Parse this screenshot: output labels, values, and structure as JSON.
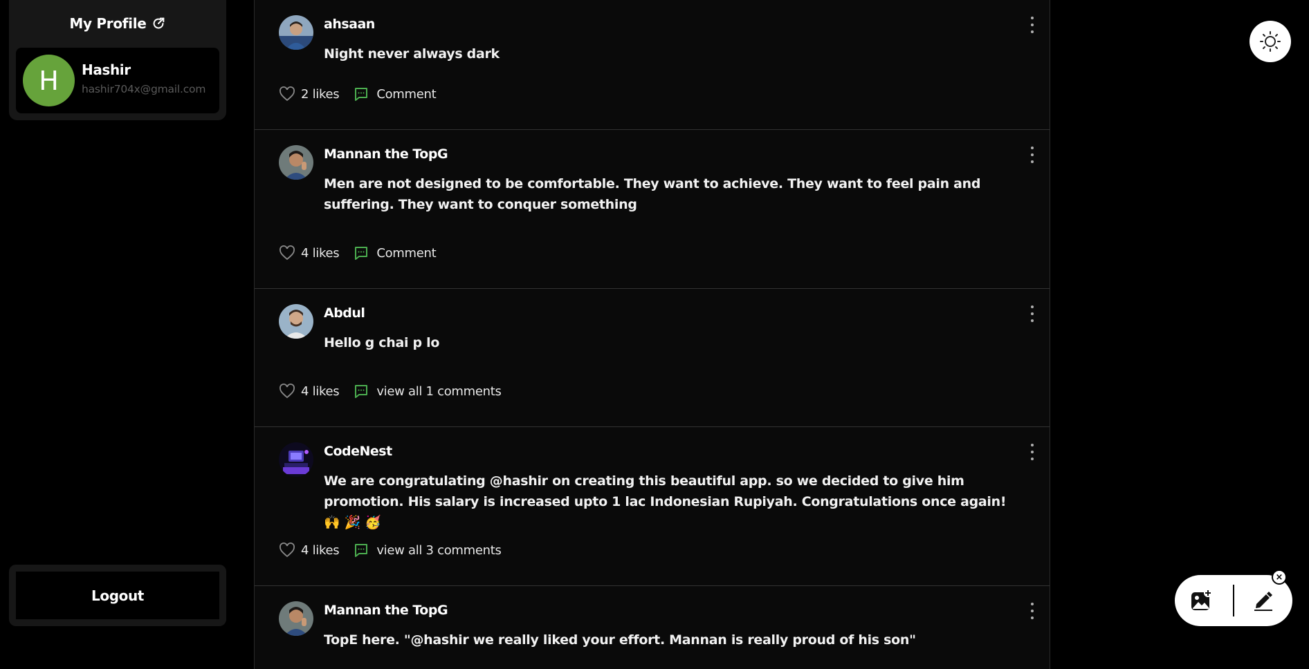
{
  "sidebar": {
    "profile_title": "My Profile",
    "user": {
      "initial": "H",
      "name": "Hashir",
      "email": "hashir704x@gmail.com"
    },
    "logout_label": "Logout"
  },
  "colors": {
    "accent_green": "#4caf50",
    "avatar_green": "#66a33b",
    "background": "#000000",
    "feed_background": "#0a0a0a"
  },
  "feed": {
    "posts": [
      {
        "author": "ahsaan",
        "text": "Night never always dark",
        "likes": "2 likes",
        "comment_label": "Comment"
      },
      {
        "author": "Mannan the TopG",
        "text": "Men are not designed to be comfortable. They want to achieve. They want to feel pain and suffering. They want to conquer something",
        "likes": "4 likes",
        "comment_label": "Comment"
      },
      {
        "author": "Abdul",
        "text": "Hello g chai p lo",
        "likes": "4 likes",
        "comment_label": "view all 1 comments"
      },
      {
        "author": "CodeNest",
        "text": "We are congratulating @hashir on creating this beautiful app. so we decided to give him promotion. His salary is increased upto 1 lac Indonesian Rupiyah. Congratulations once again! 🙌 🎉 🥳",
        "likes": "4 likes",
        "comment_label": "view all 3 comments"
      },
      {
        "author": "Mannan the TopG",
        "text": "TopE here. \"@hashir we really liked your effort. Mannan is really proud of his son\""
      }
    ]
  },
  "icons": {
    "theme": "sun-icon",
    "like": "heart-icon",
    "comment": "comment-icon",
    "menu": "more-vertical-icon",
    "image_upload": "image-add-icon",
    "edit": "pen-icon",
    "close": "close-icon",
    "profile_link": "external-link-icon"
  },
  "fab": {
    "close_glyph": "×"
  }
}
